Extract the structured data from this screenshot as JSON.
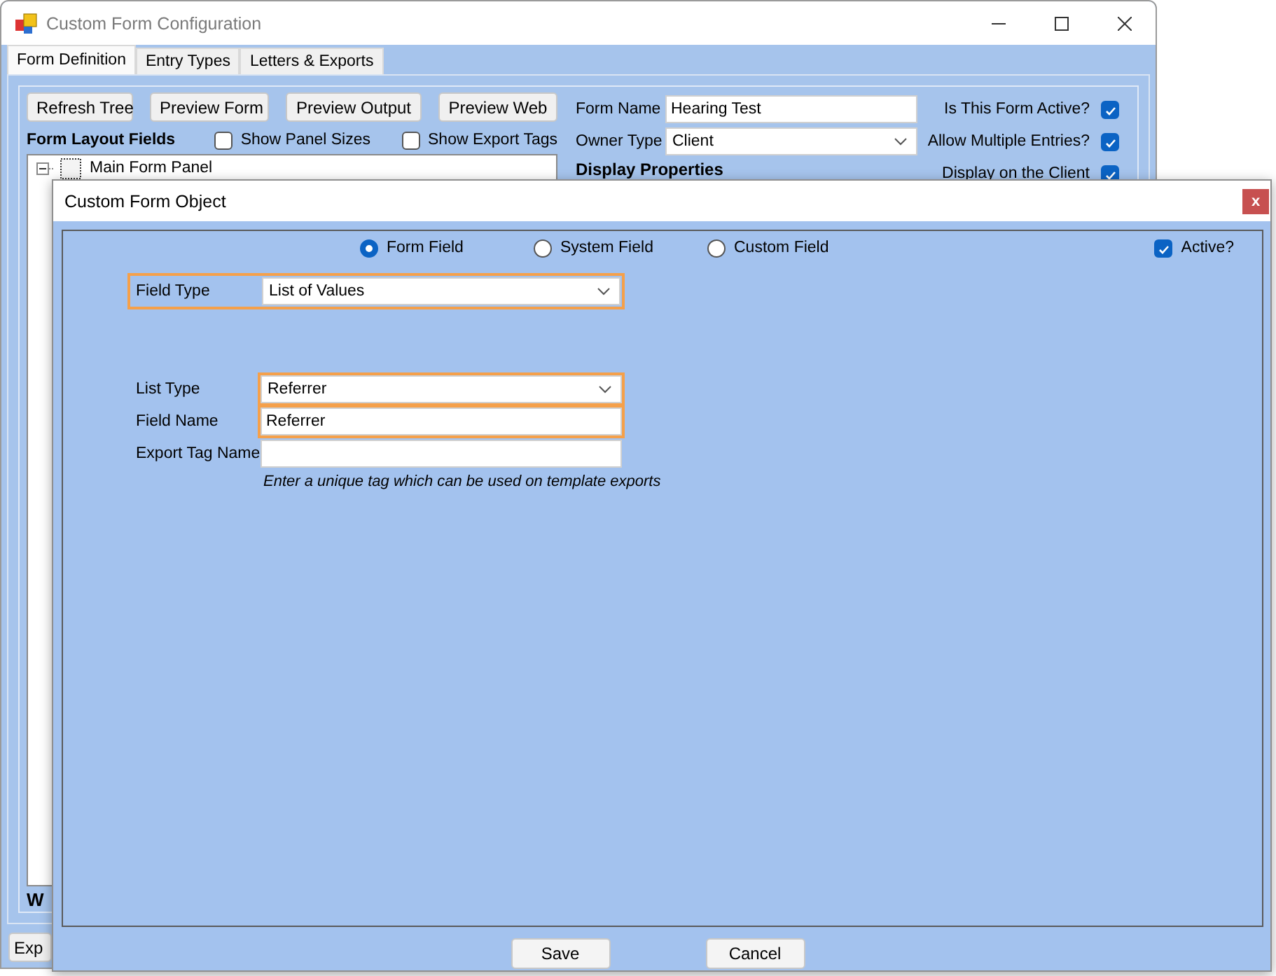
{
  "main_window": {
    "title": "Custom Form Configuration",
    "tabs": [
      {
        "label": "Form Definition",
        "selected": true
      },
      {
        "label": "Entry Types",
        "selected": false
      },
      {
        "label": "Letters & Exports",
        "selected": false
      }
    ],
    "toolbar_buttons": [
      "Refresh Tree",
      "Preview Form",
      "Preview Output",
      "Preview Web"
    ],
    "layout_heading": "Form Layout Fields",
    "options": [
      {
        "label": "Show Panel Sizes",
        "checked": false
      },
      {
        "label": "Show Export Tags",
        "checked": false
      }
    ],
    "tree": [
      {
        "label": "Main Form Panel",
        "expanded": true
      }
    ],
    "form_name": {
      "label": "Form Name",
      "value": "Hearing Test"
    },
    "owner_type": {
      "label": "Owner Type",
      "value": "Client"
    },
    "display_heading": "Display Properties",
    "flags": [
      {
        "label": "Is This Form Active?",
        "checked": true
      },
      {
        "label": "Allow Multiple Entries?",
        "checked": true
      },
      {
        "label": "Display on the Client",
        "checked": true
      }
    ],
    "bottom_heading": "W",
    "bottom_button": "Exp"
  },
  "dialog": {
    "title": "Custom Form Object",
    "close": "x",
    "sources": [
      {
        "label": "Form Field",
        "selected": true
      },
      {
        "label": "System Field",
        "selected": false
      },
      {
        "label": "Custom Field",
        "selected": false
      }
    ],
    "active": {
      "label": "Active?",
      "checked": true
    },
    "field_type": {
      "label": "Field Type",
      "value": "List of Values",
      "highlighted": true
    },
    "fields": [
      {
        "kind": "dropdown",
        "label": "List Type",
        "value": "Referrer",
        "highlighted": true
      },
      {
        "kind": "text",
        "label": "Field Name",
        "value": "Referrer",
        "highlighted": true
      },
      {
        "kind": "text",
        "label": "Export Tag Name",
        "highlighted": false
      }
    ],
    "hint": "Enter a unique tag which can be used on template exports",
    "buttons": [
      "Save",
      "Cancel"
    ]
  }
}
